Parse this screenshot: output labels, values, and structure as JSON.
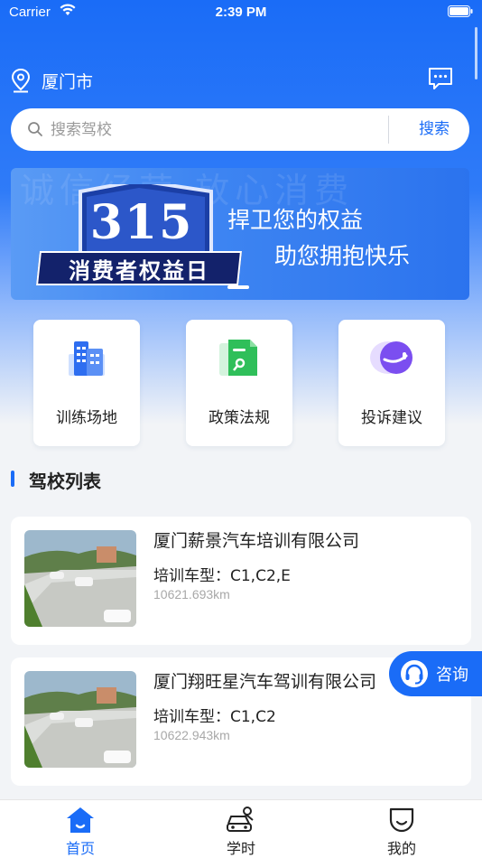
{
  "status_bar": {
    "carrier": "Carrier",
    "time": "2:39 PM"
  },
  "location": {
    "city": "厦门市"
  },
  "search": {
    "placeholder": "搜索驾校",
    "button_label": "搜索"
  },
  "banner": {
    "watermark": "诚信经营 放心消费",
    "badge_number": "315",
    "badge_text": "消费者权益日",
    "slogan_line1": "捍卫您的权益",
    "slogan_line2": "助您拥抱快乐"
  },
  "quick_menu": [
    {
      "label": "训练场地",
      "icon": "building-icon",
      "color": "#2e6ef0"
    },
    {
      "label": "政策法规",
      "icon": "document-icon",
      "color": "#2fbf5a"
    },
    {
      "label": "投诉建议",
      "icon": "feedback-icon",
      "color": "#7b4ef0"
    }
  ],
  "section": {
    "title": "驾校列表"
  },
  "schools": [
    {
      "name": "厦门薪景汽车培训有限公司",
      "types": "培训车型：C1,C2,E",
      "distance": "10621.693km"
    },
    {
      "name": "厦门翔旺星汽车驾训有限公司",
      "types": "培训车型：C1,C2",
      "distance": "10622.943km"
    }
  ],
  "consult": {
    "label": "咨询"
  },
  "tab_bar": {
    "items": [
      {
        "label": "首页",
        "icon": "home-icon",
        "active": true
      },
      {
        "label": "学时",
        "icon": "car-driver-icon",
        "active": false
      },
      {
        "label": "我的",
        "icon": "profile-icon",
        "active": false
      }
    ]
  },
  "colors": {
    "primary": "#1a6cf7",
    "background": "#f2f4f7"
  }
}
